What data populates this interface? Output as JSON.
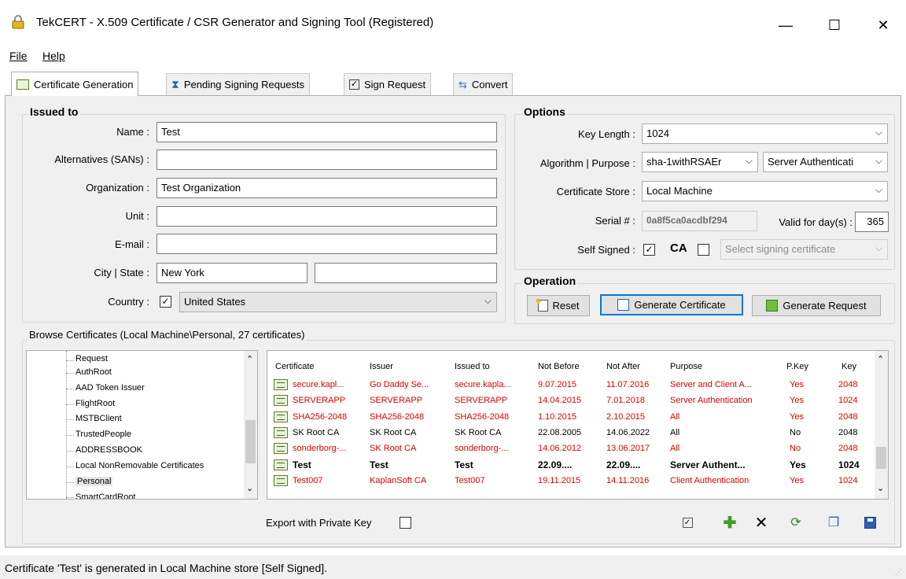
{
  "window": {
    "title": "TekCERT - X.509 Certificate / CSR Generator and Signing Tool (Registered)",
    "minimize": "—",
    "maximize": "☐",
    "close": "✕"
  },
  "menu": {
    "file": "File",
    "help": "Help"
  },
  "tabs": [
    {
      "label": "Certificate Generation",
      "active": true
    },
    {
      "label": "Pending Signing Requests",
      "active": false
    },
    {
      "label": "Sign Request",
      "active": false
    },
    {
      "label": "Convert",
      "active": false
    }
  ],
  "issued_to": {
    "title": "Issued to",
    "name_label": "Name :",
    "name_value": "Test",
    "sans_label": "Alternatives (SANs) :",
    "sans_value": "",
    "org_label": "Organization :",
    "org_value": "Test Organization",
    "unit_label": "Unit :",
    "unit_value": "",
    "email_label": "E-mail :",
    "email_value": "",
    "city_label": "City | State :",
    "city_value": "New York",
    "state_value": "",
    "country_label": "Country :",
    "country_value": "United States"
  },
  "options": {
    "title": "Options",
    "keylen_label": "Key Length :",
    "keylen_value": "1024",
    "algo_label": "Algorithm | Purpose :",
    "algo_value": "sha-1withRSAEr",
    "purpose_value": "Server Authenticati",
    "store_label": "Certificate Store :",
    "store_value": "Local Machine",
    "serial_label": "Serial # :",
    "serial_value": "0a8f5ca0acdbf294",
    "valid_label": "Valid for day(s) :",
    "valid_value": "365",
    "selfsigned_label": "Self Signed :",
    "ca_label": "CA",
    "signing_cert_placeholder": "Select signing certificate"
  },
  "operation": {
    "title": "Operation",
    "reset": "Reset",
    "generate_certificate": "Generate Certificate",
    "generate_request": "Generate Request"
  },
  "browse": {
    "title": "Browse Certificates (Local Machine\\Personal, 27 certificates)",
    "tree": [
      "Request",
      "AuthRoot",
      "AAD Token Issuer",
      "FlightRoot",
      "MSTBClient",
      "TrustedPeople",
      "ADDRESSBOOK",
      "Local NonRemovable Certificates",
      "Personal",
      "SmartCardRoot"
    ],
    "columns": [
      "Certificate",
      "Issuer",
      "Issued to",
      "Not Before",
      "Not After",
      "Purpose",
      "P.Key",
      "Key"
    ],
    "rows": [
      {
        "certificate": "secure.kapl...",
        "issuer": "Go Daddy Se...",
        "issued_to": "secure.kapla...",
        "not_before": "9.07.2015",
        "not_after": "11.07.2016",
        "purpose": "Server and Client A...",
        "pkey": "Yes",
        "key": "2048",
        "style": "red"
      },
      {
        "certificate": "SERVERAPP",
        "issuer": "SERVERAPP",
        "issued_to": "SERVERAPP",
        "not_before": "14.04.2015",
        "not_after": "7.01.2018",
        "purpose": "Server Authentication",
        "pkey": "Yes",
        "key": "1024",
        "style": "red"
      },
      {
        "certificate": "SHA256-2048",
        "issuer": "SHA256-2048",
        "issued_to": "SHA256-2048",
        "not_before": "1.10.2015",
        "not_after": "2.10.2015",
        "purpose": "All",
        "pkey": "Yes",
        "key": "2048",
        "style": "red"
      },
      {
        "certificate": "SK Root CA",
        "issuer": "SK Root CA",
        "issued_to": "SK Root CA",
        "not_before": "22.08.2005",
        "not_after": "14.06.2022",
        "purpose": "All",
        "pkey": "No",
        "key": "2048",
        "style": "normal"
      },
      {
        "certificate": "sonderborg-...",
        "issuer": "SK Root CA",
        "issued_to": "sonderborg-...",
        "not_before": "14.06.2012",
        "not_after": "13.06.2017",
        "purpose": "All",
        "pkey": "No",
        "key": "2048",
        "style": "red"
      },
      {
        "certificate": "Test",
        "issuer": "Test",
        "issued_to": "Test",
        "not_before": "22.09....",
        "not_after": "22.09....",
        "purpose": "Server Authent...",
        "pkey": "Yes",
        "key": "1024",
        "style": "bold"
      },
      {
        "certificate": "Test007",
        "issuer": "KaplanSoft CA",
        "issued_to": "Test007",
        "not_before": "19.11.2015",
        "not_after": "14.11.2016",
        "purpose": "Client Authentication",
        "pkey": "Yes",
        "key": "1024",
        "style": "red"
      }
    ],
    "export_label": "Export with Private Key"
  },
  "status": "Certificate 'Test' is generated in Local Machine store [Self Signed].",
  "colors": {
    "red_row": "#e00000",
    "focus": "#0078d7",
    "panel": "#f0f0f0"
  }
}
